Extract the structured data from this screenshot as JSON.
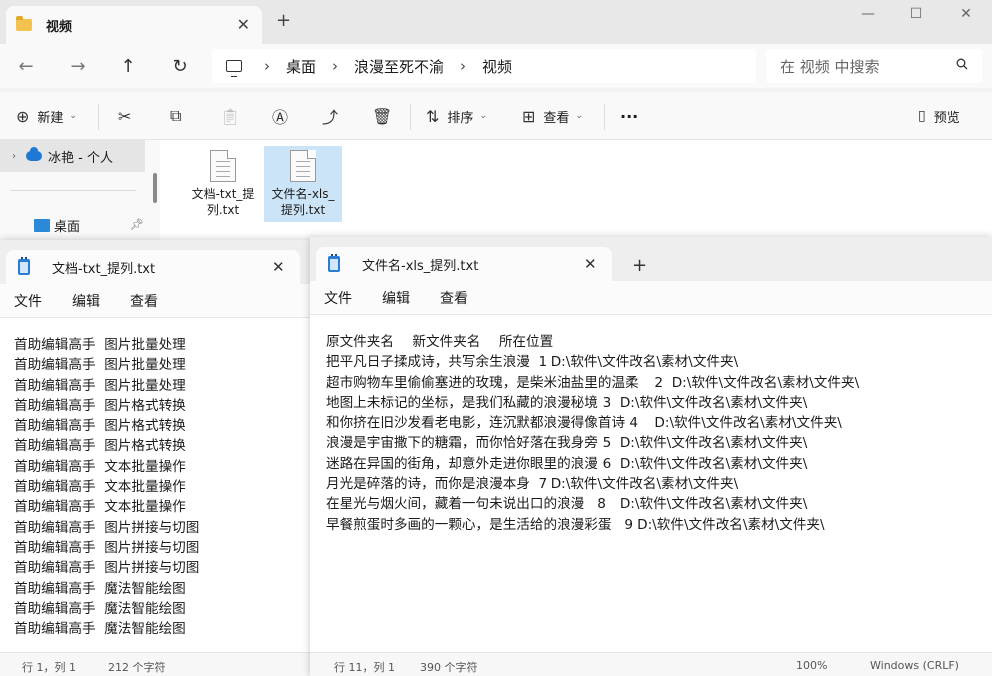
{
  "explorer": {
    "tab_title": "视频",
    "breadcrumb": [
      "桌面",
      "浪漫至死不渝",
      "视频"
    ],
    "search_placeholder": "在 视频 中搜索",
    "toolbar": {
      "new": "新建",
      "sort": "排序",
      "view": "查看",
      "more": "···",
      "preview": "预览"
    },
    "nav": {
      "onedrive": "冰艳 - 个人",
      "desktop": "桌面"
    },
    "files": [
      {
        "name_line1": "文档-txt_提",
        "name_line2": "列.txt"
      },
      {
        "name_line1": "文件名-xls_",
        "name_line2": "提列.txt"
      }
    ]
  },
  "notepad_left": {
    "tab_title": "文档-txt_提列.txt",
    "menu": [
      "文件",
      "编辑",
      "查看"
    ],
    "lines": [
      "首助编辑高手  图片批量处理",
      "首助编辑高手  图片批量处理",
      "首助编辑高手  图片批量处理",
      "首助编辑高手  图片格式转换",
      "首助编辑高手  图片格式转换",
      "首助编辑高手  图片格式转换",
      "首助编辑高手  文本批量操作",
      "首助编辑高手  文本批量操作",
      "首助编辑高手  文本批量操作",
      "首助编辑高手  图片拼接与切图",
      "首助编辑高手  图片拼接与切图",
      "首助编辑高手  图片拼接与切图",
      "首助编辑高手  魔法智能绘图",
      "首助编辑高手  魔法智能绘图",
      "首助编辑高手  魔法智能绘图"
    ],
    "status_pos": "行 1，列 1",
    "status_count": "212 个字符"
  },
  "notepad_right": {
    "tab_title": "文件名-xls_提列.txt",
    "menu": [
      "文件",
      "编辑",
      "查看"
    ],
    "lines": [
      "原文件夹名\t新文件夹名\t所在位置",
      "把平凡日子揉成诗，共写余生浪漫  1\tD:\\软件\\文件改名\\素材\\文件夹\\",
      "超市购物车里偷偷塞进的玫瑰，是柴米油盐里的温柔\t2\tD:\\软件\\文件改名\\素材\\文件夹\\",
      "地图上未标记的坐标，是我们私藏的浪漫秘境\t3\tD:\\软件\\文件改名\\素材\\文件夹\\",
      "和你挤在旧沙发看老电影，连沉默都浪漫得像首诗 4\tD:\\软件\\文件改名\\素材\\文件夹\\",
      "浪漫是宇宙撒下的糖霜，而你恰好落在我身旁\t5\tD:\\软件\\文件改名\\素材\\文件夹\\",
      "迷路在异国的街角，却意外走进你眼里的浪漫\t6\tD:\\软件\\文件改名\\素材\\文件夹\\",
      "月光是碎落的诗，而你是浪漫本身  7\tD:\\软件\\文件改名\\素材\\文件夹\\",
      "在星光与烟火间，藏着一句未说出口的浪漫   8\tD:\\软件\\文件改名\\素材\\文件夹\\",
      "早餐煎蛋时多画的一颗心，是生活给的浪漫彩蛋   9\tD:\\软件\\文件改名\\素材\\文件夹\\"
    ],
    "status_pos": "行 11，列 1",
    "status_count": "390 个字符",
    "status_zoom": "100%",
    "status_eol": "Windows (CRLF)"
  }
}
